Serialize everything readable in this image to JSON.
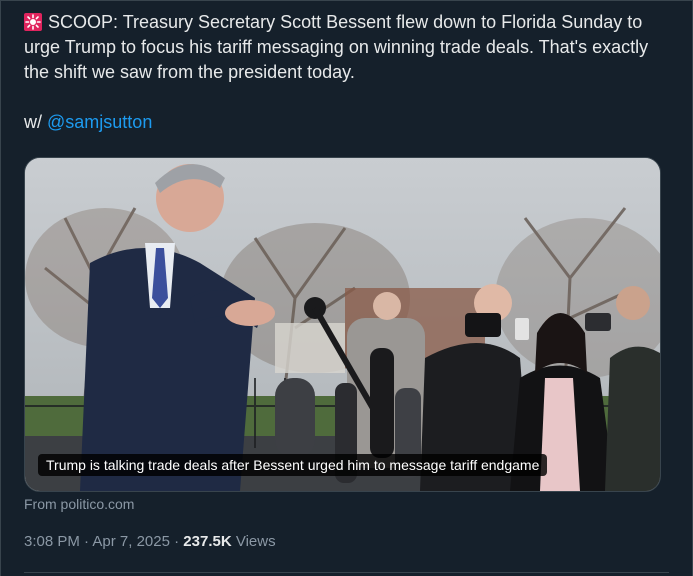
{
  "tweet": {
    "line1": "SCOOP: Treasury Secretary Scott Bessent flew down to Florida Sunday to urge Trump to focus his tariff messaging on winning trade deals. That's exactly the shift we saw from the president today.",
    "credit_prefix": "w/ ",
    "mention": "@samjsutton",
    "emoji_icon": "rotating-light-icon"
  },
  "media": {
    "caption": "Trump is talking trade deals after Bessent urged him to message tariff endgame",
    "source": "From politico.com"
  },
  "meta": {
    "time": "3:08 PM",
    "sep1": " · ",
    "date": "Apr 7, 2025",
    "sep2": " · ",
    "views_count": "237.5K",
    "views_label": " Views"
  },
  "colors": {
    "background": "#15202b",
    "text": "#e7e9ea",
    "muted": "#8b98a5",
    "link": "#1d9bf0",
    "alarm_red": "#e0245e"
  }
}
